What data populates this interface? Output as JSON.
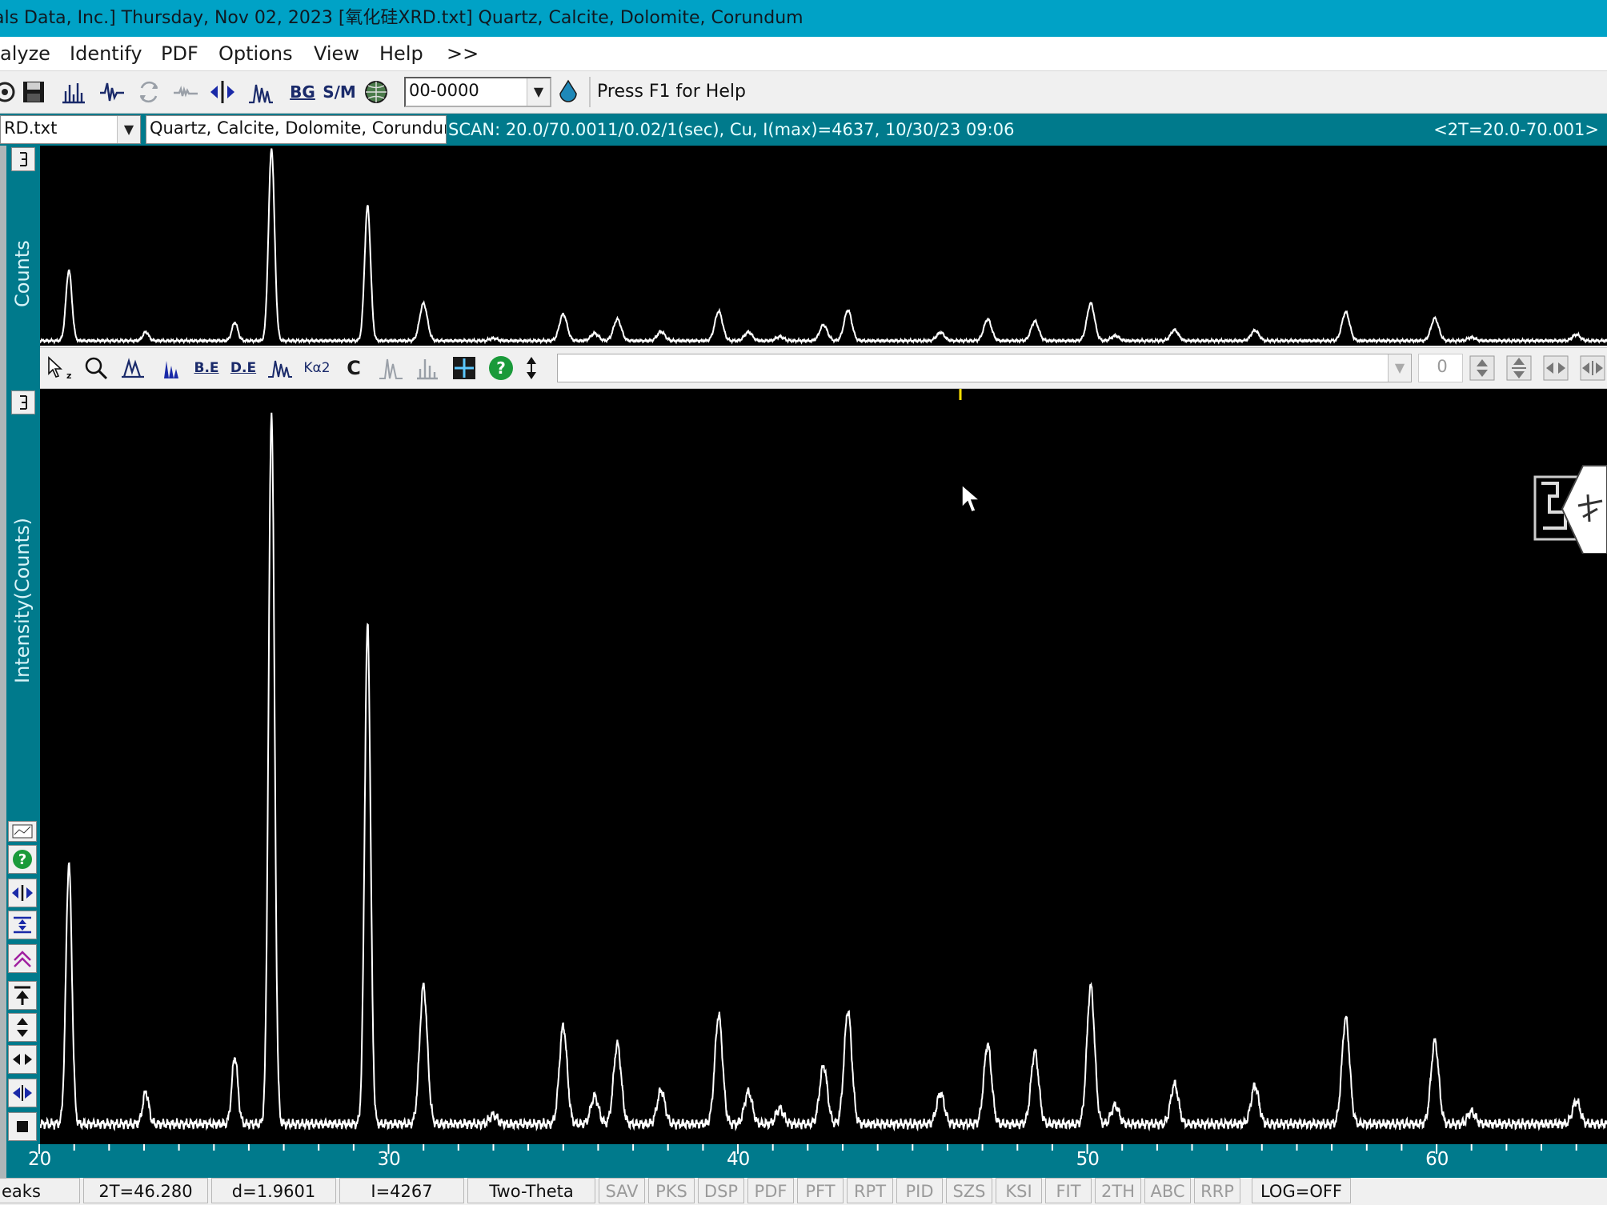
{
  "window": {
    "title": "als Data, Inc.] Thursday, Nov 02, 2023 [氧化硅XRD.txt] Quartz, Calcite, Dolomite, Corundum"
  },
  "menu": {
    "items": [
      "alyze",
      "Identify",
      "PDF",
      "Options",
      "View",
      "Help",
      ">>"
    ]
  },
  "toolbar": {
    "pdf_combo_value": "00-0000",
    "help_text": "Press F1 for Help",
    "icons": [
      "tool-icon",
      "save-icon",
      "bar-plot-icon",
      "peak-icon",
      "refresh-icon",
      "smooth-icon",
      "pan-icon",
      "peaks-icon",
      "bg-icon",
      "sm-icon",
      "globe-icon"
    ],
    "bg_label": "BG",
    "sm_label": "S/M"
  },
  "scan_bar": {
    "file_combo": "RD.txt",
    "phase_field": "Quartz, Calcite, Dolomite, Corundum",
    "scan_info": "SCAN: 20.0/70.0011/0.02/1(sec), Cu, I(max)=4637, 10/30/23 09:06",
    "range": "<2T=20.0-70.001>"
  },
  "plot_top": {
    "ylabel": "Counts"
  },
  "plot_main": {
    "ylabel": "Intensity(Counts)"
  },
  "mid_toolbar": {
    "buttons": [
      "B.E",
      "D.E",
      "Kα2",
      "C"
    ],
    "spin_value": "0"
  },
  "chart_data": {
    "type": "line",
    "xlabel": "Two-Theta",
    "ylabel": "Intensity(Counts)",
    "xlim": [
      20,
      66
    ],
    "ylim": [
      0,
      4637
    ],
    "xticks": [
      20,
      30,
      40,
      50,
      60
    ],
    "baseline": 80,
    "peaks": [
      {
        "x": 20.85,
        "y": 1700
      },
      {
        "x": 23.05,
        "y": 210
      },
      {
        "x": 25.6,
        "y": 440
      },
      {
        "x": 26.65,
        "y": 4637
      },
      {
        "x": 29.4,
        "y": 3250
      },
      {
        "x": 31.0,
        "y": 900
      },
      {
        "x": 33.0,
        "y": 60
      },
      {
        "x": 35.0,
        "y": 640
      },
      {
        "x": 35.9,
        "y": 180
      },
      {
        "x": 36.55,
        "y": 520
      },
      {
        "x": 37.8,
        "y": 220
      },
      {
        "x": 39.45,
        "y": 710
      },
      {
        "x": 40.3,
        "y": 210
      },
      {
        "x": 41.2,
        "y": 100
      },
      {
        "x": 42.45,
        "y": 380
      },
      {
        "x": 43.15,
        "y": 740
      },
      {
        "x": 45.8,
        "y": 200
      },
      {
        "x": 47.15,
        "y": 520
      },
      {
        "x": 48.5,
        "y": 470
      },
      {
        "x": 50.1,
        "y": 900
      },
      {
        "x": 50.8,
        "y": 120
      },
      {
        "x": 52.5,
        "y": 260
      },
      {
        "x": 54.8,
        "y": 250
      },
      {
        "x": 57.4,
        "y": 690
      },
      {
        "x": 59.95,
        "y": 540
      },
      {
        "x": 61.0,
        "y": 80
      },
      {
        "x": 64.0,
        "y": 150
      }
    ]
  },
  "status_bar": {
    "mode": "eaks",
    "two_theta": "2T=46.280",
    "d_spacing": "d=1.9601",
    "intensity": "I=4267",
    "axis": "Two-Theta",
    "flags": [
      "SAV",
      "PKS",
      "DSP",
      "PDF",
      "PFT",
      "RPT",
      "PID",
      "SZS",
      "KSI",
      "FIT",
      "2TH",
      "ABC",
      "RRP"
    ],
    "log": "LOG=OFF"
  }
}
